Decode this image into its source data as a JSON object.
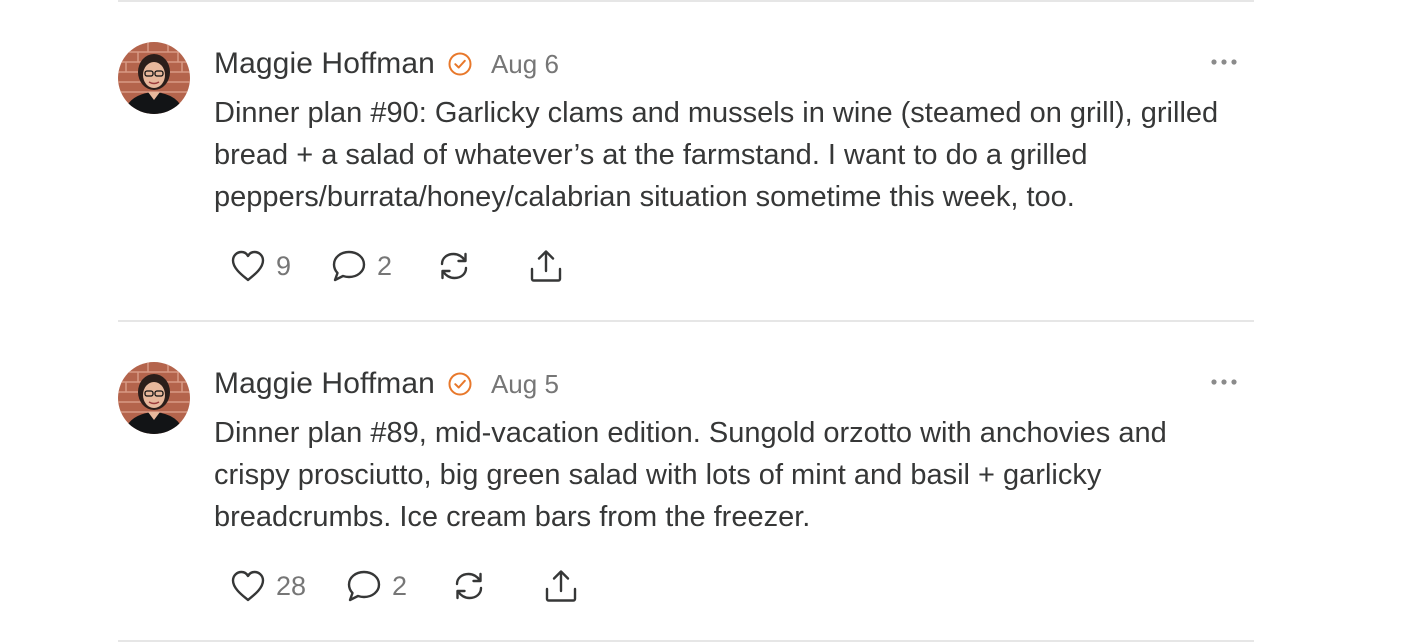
{
  "colors": {
    "text": "#363737",
    "muted": "#767676",
    "accent_verified": "#e8782b",
    "divider": "#e6e6e6"
  },
  "icons": {
    "verified": "verified-check-icon",
    "more": "more-ellipsis-icon",
    "like": "heart-icon",
    "comment": "comment-bubble-icon",
    "restack": "restack-icon",
    "share": "share-icon"
  },
  "posts": [
    {
      "author": "Maggie Hoffman",
      "date": "Aug 6",
      "text": "Dinner plan #90: Garlicky clams and mussels in wine (steamed on grill), grilled bread + a salad of whatever’s at the farmstand. I want to do a grilled peppers/burrata/honey/calabrian situation sometime this week, too.",
      "likes": "9",
      "comments": "2"
    },
    {
      "author": "Maggie Hoffman",
      "date": "Aug 5",
      "text": "Dinner plan #89, mid-vacation edition. Sungold orzotto with anchovies and crispy prosciutto, big green salad with lots of mint and basil + garlicky breadcrumbs. Ice cream bars from the freezer.",
      "likes": "28",
      "comments": "2"
    }
  ]
}
